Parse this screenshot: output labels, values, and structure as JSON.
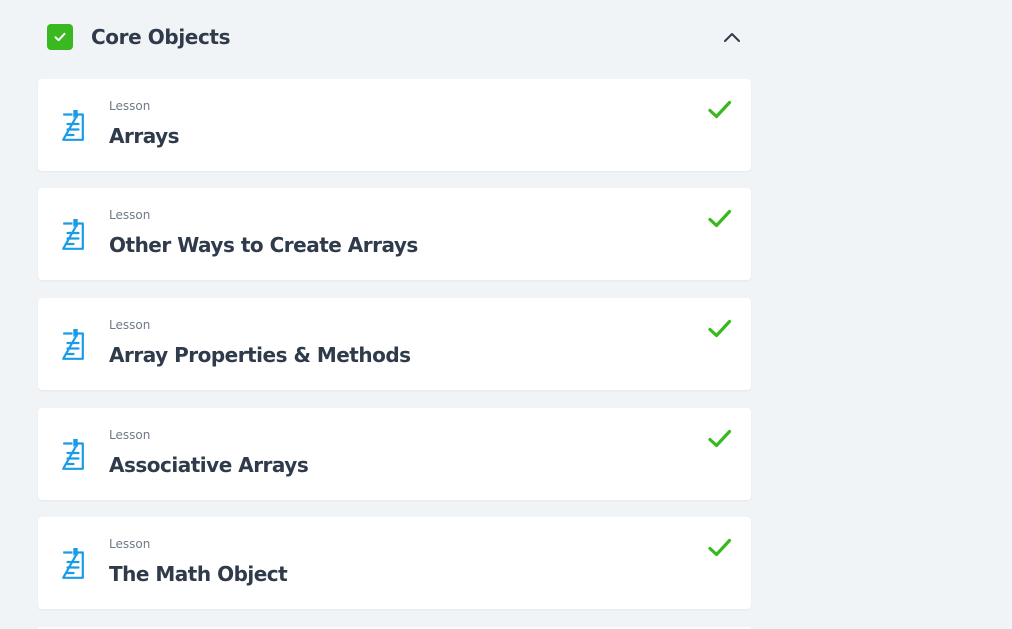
{
  "section": {
    "title": "Core Objects",
    "completed": true,
    "expanded": true,
    "status_icon": "checkbox-checked-icon",
    "toggle_icon": "chevron-up-icon"
  },
  "colors": {
    "background": "#f1f4f7",
    "card": "#ffffff",
    "success": "#39b81f",
    "icon": "#1a9be8",
    "title_text": "#2f3b4b",
    "meta_text": "#6f7a88"
  },
  "lessons": [
    {
      "type": "Lesson",
      "title": "Arrays",
      "icon": "lesson-document-icon",
      "status": "completed",
      "status_icon": "checkmark-icon"
    },
    {
      "type": "Lesson",
      "title": "Other Ways to Create Arrays",
      "icon": "lesson-document-icon",
      "status": "completed",
      "status_icon": "checkmark-icon"
    },
    {
      "type": "Lesson",
      "title": "Array Properties & Methods",
      "icon": "lesson-document-icon",
      "status": "completed",
      "status_icon": "checkmark-icon"
    },
    {
      "type": "Lesson",
      "title": "Associative Arrays",
      "icon": "lesson-document-icon",
      "status": "completed",
      "status_icon": "checkmark-icon"
    },
    {
      "type": "Lesson",
      "title": "The Math Object",
      "icon": "lesson-document-icon",
      "status": "completed",
      "status_icon": "checkmark-icon"
    }
  ]
}
